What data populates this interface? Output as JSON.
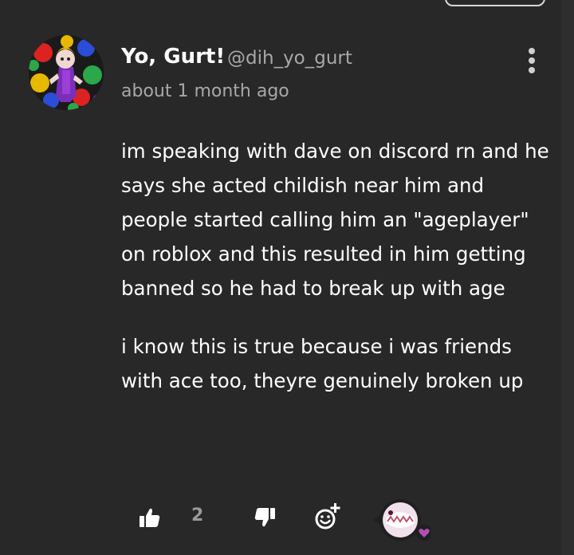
{
  "comment": {
    "author": {
      "display_name": "Yo, Gurt!",
      "handle": "@dih_yo_gurt"
    },
    "timestamp": "about 1 month ago",
    "paragraphs": [
      "im speaking with dave on discord rn and he says she acted childish near him and people started calling him an \"ageplayer\" on roblox and this resulted in him getting banned so he had to break up with age",
      "i know this is true because i was friends with ace too, theyre genuinely broken up"
    ],
    "actions": {
      "like_count": "2"
    }
  },
  "icons": {
    "menu": "more-vertical-icon",
    "like": "thumbs-up-icon",
    "dislike": "thumbs-down-icon",
    "react": "add-reaction-icon",
    "reaction_badge": "heart-icon"
  },
  "colors": {
    "background": "#282828",
    "text_primary": "#ffffff",
    "text_secondary": "#a8a8a8",
    "reaction_heart": "#b04fb8"
  }
}
